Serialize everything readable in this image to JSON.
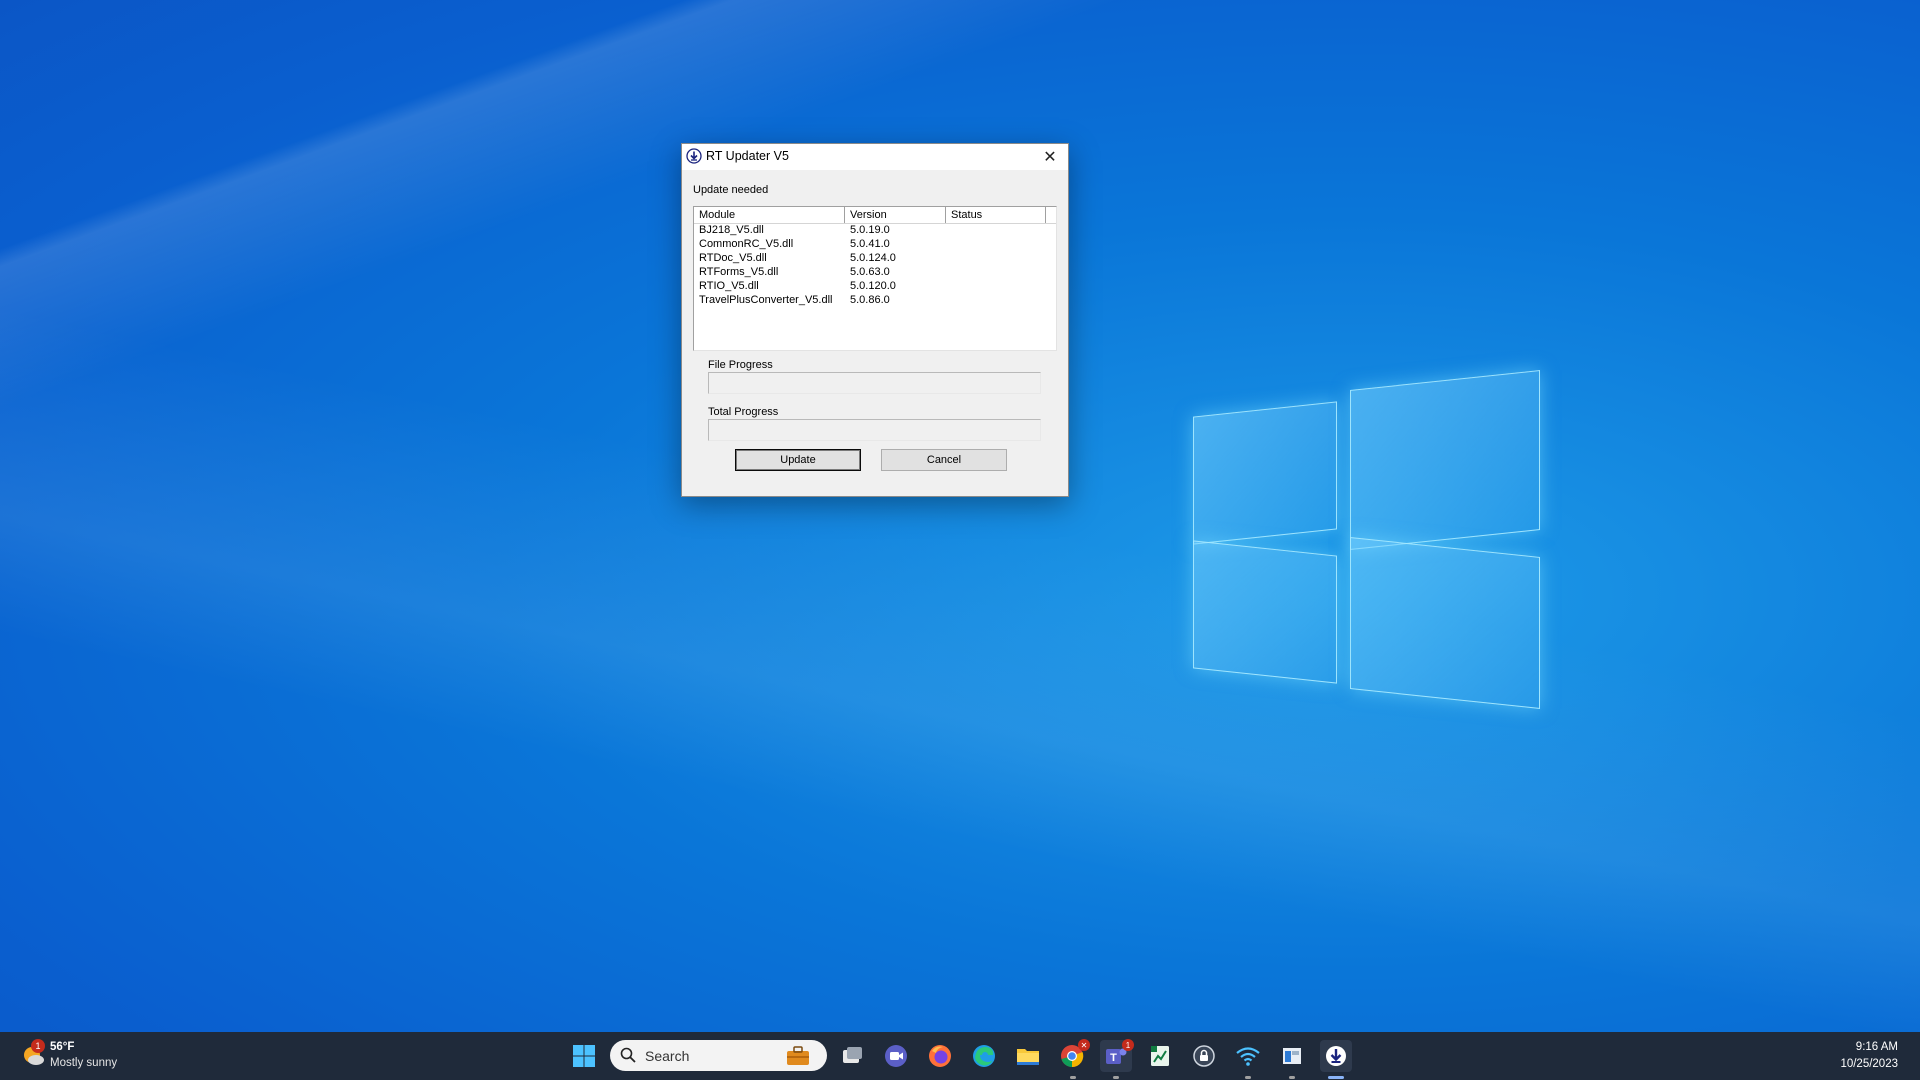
{
  "dialog": {
    "title": "RT Updater V5",
    "close_glyph": "✕",
    "status_label": "Update needed",
    "columns": [
      "Module",
      "Version",
      "Status"
    ],
    "rows": [
      {
        "module": "BJ218_V5.dll",
        "version": "5.0.19.0",
        "status": ""
      },
      {
        "module": "CommonRC_V5.dll",
        "version": "5.0.41.0",
        "status": ""
      },
      {
        "module": "RTDoc_V5.dll",
        "version": "5.0.124.0",
        "status": ""
      },
      {
        "module": "RTForms_V5.dll",
        "version": "5.0.63.0",
        "status": ""
      },
      {
        "module": "RTIO_V5.dll",
        "version": "5.0.120.0",
        "status": ""
      },
      {
        "module": "TravelPlusConverter_V5.dll",
        "version": "5.0.86.0",
        "status": ""
      }
    ],
    "file_progress_label": "File Progress",
    "file_progress_value": 0,
    "total_progress_label": "Total Progress",
    "total_progress_value": 0,
    "update_label": "Update",
    "cancel_label": "Cancel"
  },
  "taskbar": {
    "weather_temp": "56°F",
    "weather_desc": "Mostly sunny",
    "weather_badge": "1",
    "search_placeholder": "Search",
    "teams_badge": "1",
    "clock_time": "9:16 AM",
    "clock_date": "10/25/2023",
    "icons": [
      "windows-start-icon",
      "search-icon",
      "work-briefcase-icon",
      "task-view-icon",
      "teams-meet-icon",
      "firefox-icon",
      "edge-icon",
      "file-explorer-icon",
      "chrome-icon",
      "teams-icon",
      "excel-icon",
      "vpn-lock-icon",
      "wifi-icon",
      "store-icon",
      "rt-updater-icon"
    ]
  },
  "colors": {
    "desktop_blue": "#0a76d8",
    "taskbar_bg": "#1f2a3a",
    "dialog_bg": "#f0f0f0",
    "badge_red": "#c42b1c"
  }
}
